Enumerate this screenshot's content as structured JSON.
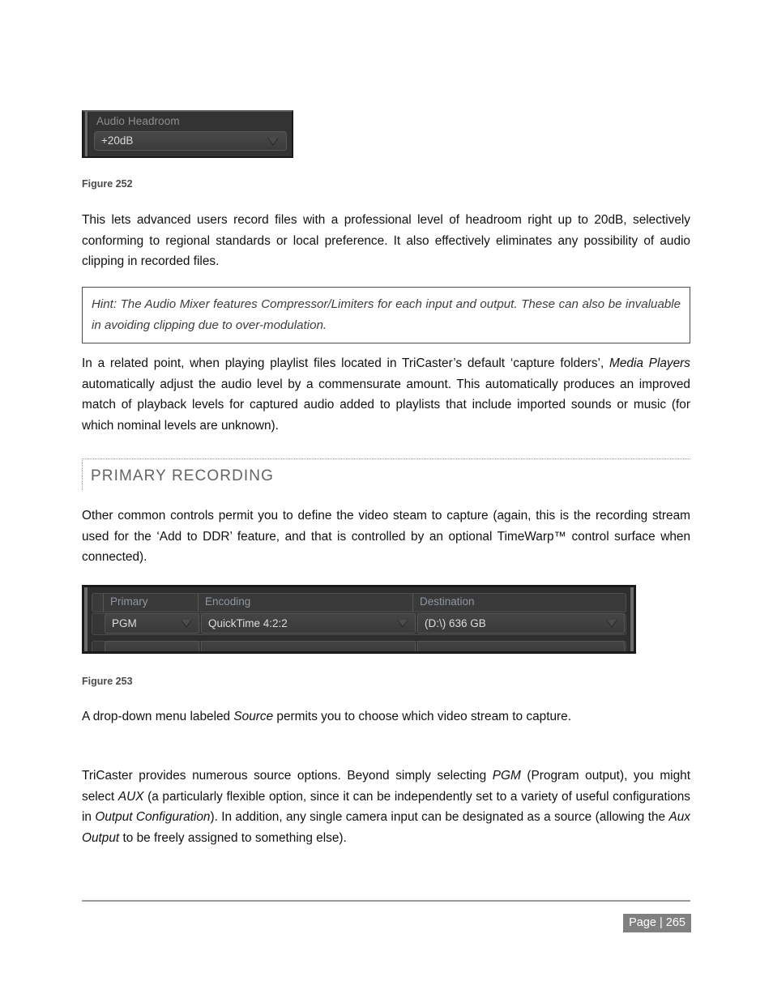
{
  "document": {
    "page_number_label": "Page | 265"
  },
  "figure252": {
    "caption": "Figure 252",
    "panel_label": "Audio Headroom",
    "dropdown_value": "+20dB",
    "dropdown_icon": "chevron-down-icon"
  },
  "figure253": {
    "caption": "Figure 253",
    "columns": [
      "Primary",
      "Encoding",
      "Destination"
    ],
    "row": {
      "primary": "PGM",
      "encoding": "QuickTime 4:2:2",
      "destination": "(D:\\) 636 GB"
    }
  },
  "section": {
    "heading": "PRIMARY RECORDING"
  },
  "paragraphs": {
    "p1": "This lets advanced users record files with a professional level of headroom right up to 20dB, selectively conforming to regional standards or local preference.  It also effectively eliminates any possibility of audio clipping in recorded files.",
    "hint": "Hint: The Audio Mixer features Compressor/Limiters for each input and output.  These can also be invaluable in avoiding clipping due to over-modulation.",
    "p2_part1": "In a related point, when playing playlist files located in TriCaster’s default ‘capture folders’, ",
    "p2_italic1": "Media Players",
    "p2_part2": " automatically adjust the audio level by a commensurate amount.  This automatically produces an improved match of playback levels for captured audio added to playlists that include imported sounds or music (for which nominal levels are unknown).",
    "p3": "Other common controls permit you to define the video steam to capture (again, this is the recording stream used for the ‘Add to DDR’ feature, and that is controlled by an optional TimeWarp™ control surface when connected).",
    "p4_part1": "A drop-down menu labeled ",
    "p4_italic1": "Source",
    "p4_part2": " permits you to choose which video stream to capture.",
    "p5_part1": "TriCaster provides numerous source options.  Beyond simply selecting ",
    "p5_italic1": "PGM",
    "p5_part2": " (Program output), you might select ",
    "p5_italic2": "AUX",
    "p5_part3": " (a particularly flexible option, since it can be independently set to a variety of useful configurations in ",
    "p5_italic3": "Output Configuration",
    "p5_part4": ").  In addition, any single camera input can be designated as a source (allowing the ",
    "p5_italic4": "Aux Output",
    "p5_part5": " to be freely assigned to something else)."
  }
}
